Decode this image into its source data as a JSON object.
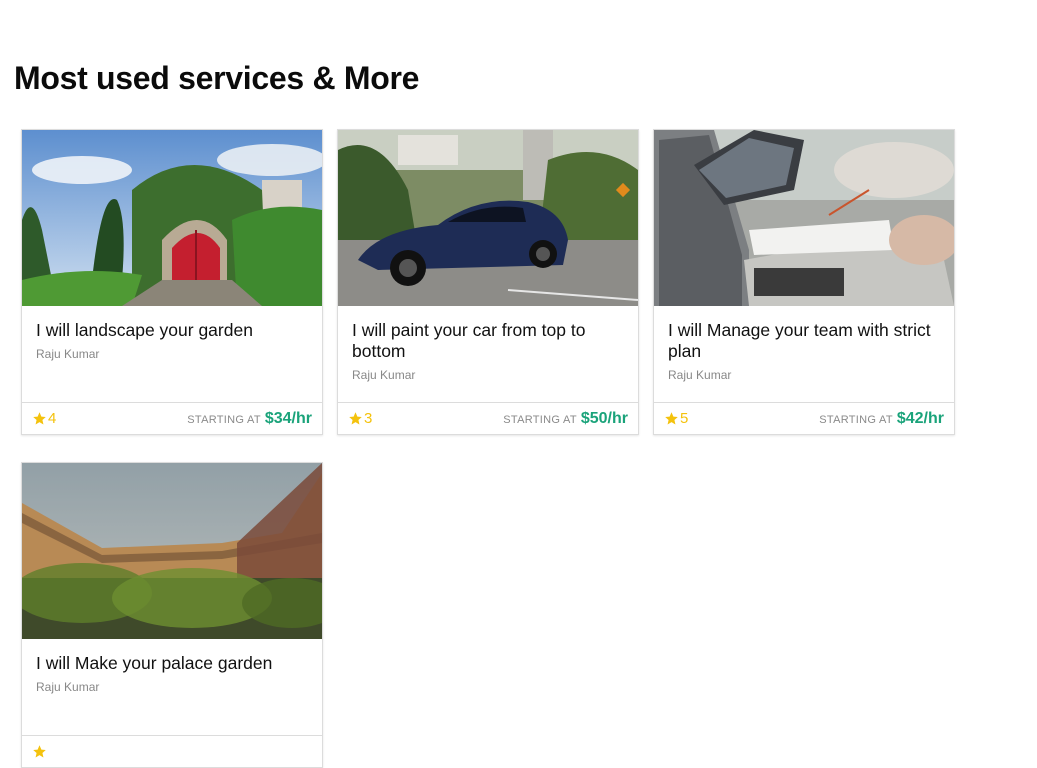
{
  "section": {
    "title": "Most used services & More"
  },
  "colors": {
    "accent_price": "#1aa37a",
    "star": "#f4c20d",
    "muted": "#888888"
  },
  "cards": [
    {
      "title": "I will landscape your garden",
      "seller": "Raju Kumar",
      "rating": "4",
      "price_label": "STARTING AT",
      "price": "$34/hr",
      "image": "garden-gate-image"
    },
    {
      "title": "I will paint your car from top to bottom",
      "seller": "Raju Kumar",
      "rating": "3",
      "price_label": "STARTING AT",
      "price": "$50/hr",
      "image": "blue-car-image"
    },
    {
      "title": "I will Manage your team with strict plan",
      "seller": "Raju Kumar",
      "rating": "5",
      "price_label": "STARTING AT",
      "price": "$42/hr",
      "image": "laptop-meeting-image"
    },
    {
      "title": "I will Make your palace garden",
      "seller": "Raju Kumar",
      "rating": "",
      "price_label": "",
      "price": "",
      "image": "fence-grass-image"
    }
  ]
}
